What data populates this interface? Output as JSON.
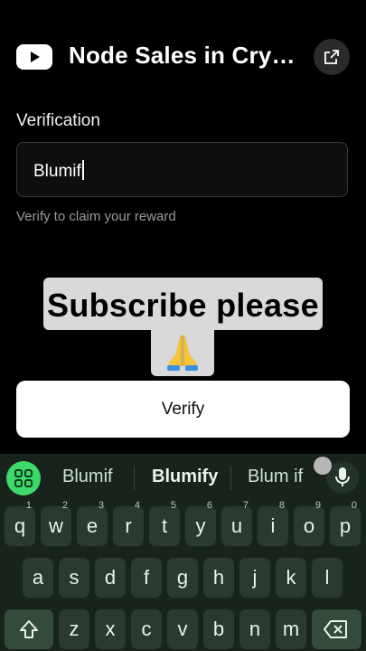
{
  "header": {
    "title": "Node Sales in Cryp…",
    "logo_icon": "youtube-logo-icon",
    "share_icon": "open-external-icon"
  },
  "form": {
    "label": "Verification",
    "value": "Blumif",
    "helper": "Verify to claim your reward",
    "submit_label": "Verify"
  },
  "overlay": {
    "text": "Subscribe please",
    "emoji": "🙏"
  },
  "keyboard": {
    "suggestions": [
      "Blumif",
      "Blumify",
      "Blum if"
    ],
    "row1": [
      {
        "k": "q",
        "n": "1"
      },
      {
        "k": "w",
        "n": "2"
      },
      {
        "k": "e",
        "n": "3"
      },
      {
        "k": "r",
        "n": "4"
      },
      {
        "k": "t",
        "n": "5"
      },
      {
        "k": "y",
        "n": "6"
      },
      {
        "k": "u",
        "n": "7"
      },
      {
        "k": "i",
        "n": "8"
      },
      {
        "k": "o",
        "n": "9"
      },
      {
        "k": "p",
        "n": "0"
      }
    ],
    "row2": [
      "a",
      "s",
      "d",
      "f",
      "g",
      "h",
      "j",
      "k",
      "l"
    ],
    "row3": [
      "z",
      "x",
      "c",
      "v",
      "b",
      "n",
      "m"
    ],
    "colors": {
      "background": "#17231b",
      "key": "#2a3a2f",
      "accent": "#3dd96a"
    }
  }
}
